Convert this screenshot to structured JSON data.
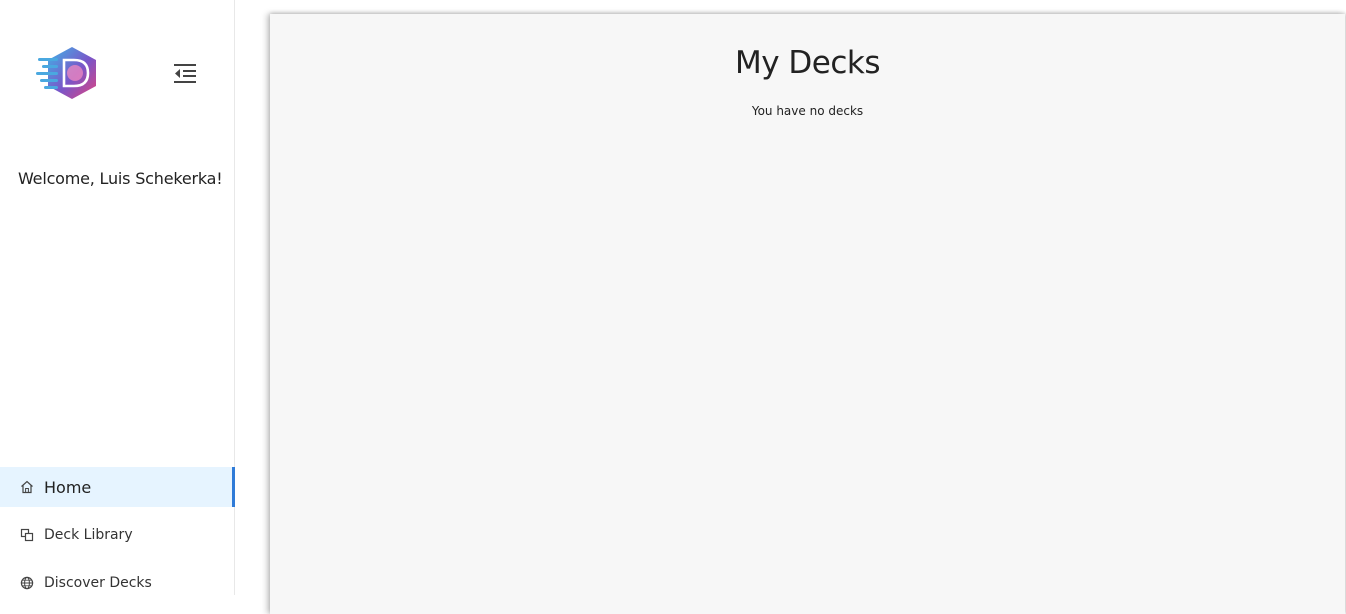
{
  "sidebar": {
    "logo_icon": "deck-logo-icon",
    "collapse_icon": "menu-fold-icon",
    "welcome": "Welcome, Luis Schekerka!",
    "items": [
      {
        "label": "Home",
        "icon": "home-icon",
        "active": true
      },
      {
        "label": "Deck Library",
        "icon": "copy-icon",
        "active": false
      },
      {
        "label": "Discover Decks",
        "icon": "globe-icon",
        "active": false
      }
    ]
  },
  "main": {
    "title": "My Decks",
    "empty_message": "You have no decks"
  },
  "colors": {
    "accent": "#2f7bd8",
    "active_bg": "#e6f4ff",
    "card_bg": "#f7f7f7"
  }
}
